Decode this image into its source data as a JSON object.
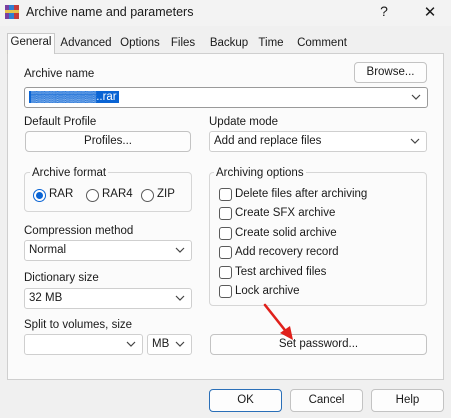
{
  "window": {
    "title": "Archive name and parameters",
    "help": "?",
    "close": "✕"
  },
  "tabs": [
    {
      "label": "General",
      "active": true
    },
    {
      "label": "Advanced"
    },
    {
      "label": "Options"
    },
    {
      "label": "Files"
    },
    {
      "label": "Backup"
    },
    {
      "label": "Time"
    },
    {
      "label": "Comment"
    }
  ],
  "archive_name": {
    "label": "Archive name",
    "browse": "Browse...",
    "value_hidden": "▒▒▒▒▒▒▒▒",
    "value_ext": "..rar"
  },
  "profile": {
    "label": "Default Profile",
    "button": "Profiles..."
  },
  "update_mode": {
    "label": "Update mode",
    "value": "Add and replace files"
  },
  "archive_format": {
    "label": "Archive format",
    "options": [
      {
        "label": "RAR",
        "selected": true
      },
      {
        "label": "RAR4",
        "selected": false
      },
      {
        "label": "ZIP",
        "selected": false
      }
    ]
  },
  "archiving_options": {
    "label": "Archiving options",
    "items": [
      {
        "label": "Delete files after archiving",
        "checked": false
      },
      {
        "label": "Create SFX archive",
        "checked": false
      },
      {
        "label": "Create solid archive",
        "checked": false
      },
      {
        "label": "Add recovery record",
        "checked": false
      },
      {
        "label": "Test archived files",
        "checked": false
      },
      {
        "label": "Lock archive",
        "checked": false
      }
    ]
  },
  "compression": {
    "label": "Compression method",
    "value": "Normal"
  },
  "dictionary": {
    "label": "Dictionary size",
    "value": "32 MB"
  },
  "split": {
    "label": "Split to volumes, size",
    "value": "",
    "unit": "MB"
  },
  "set_password": "Set password...",
  "footer": {
    "ok": "OK",
    "cancel": "Cancel",
    "help": "Help"
  },
  "colors": {
    "accent": "#0a64d4",
    "arrow": "#e0201b"
  }
}
